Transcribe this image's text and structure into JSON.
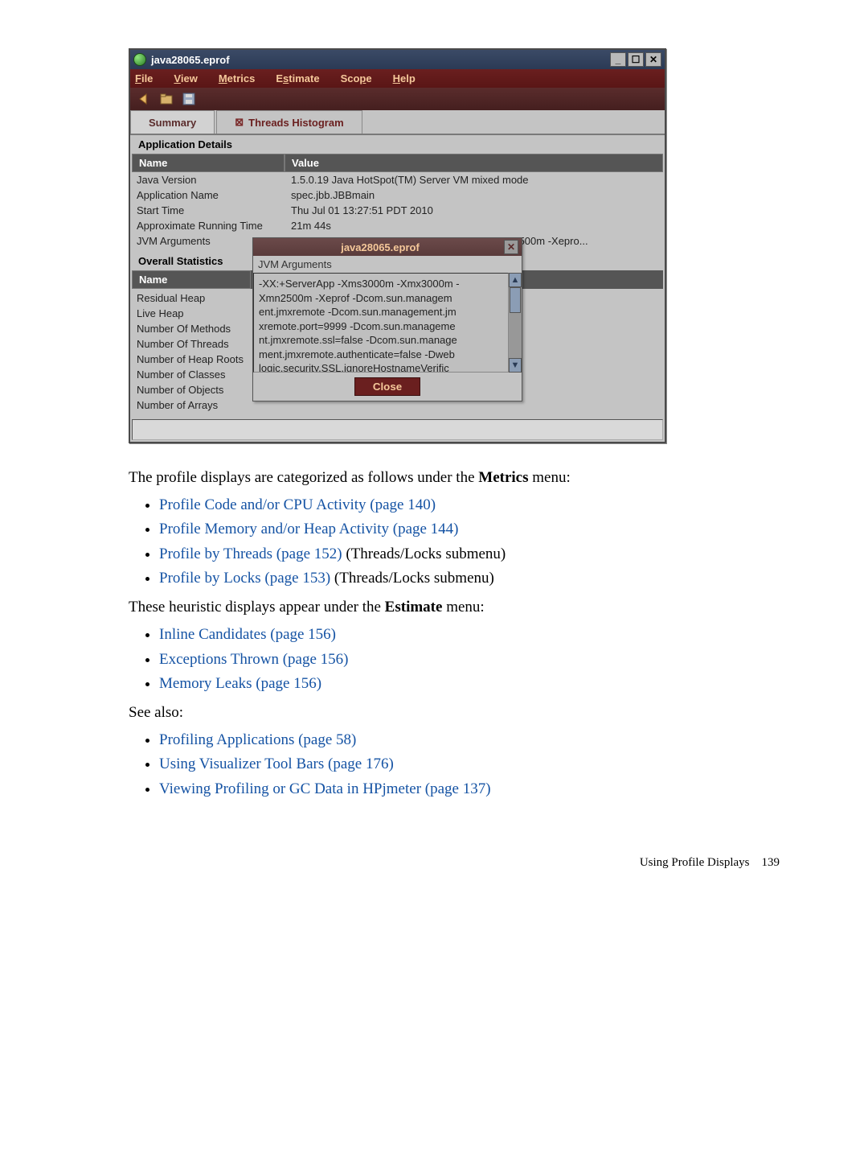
{
  "window": {
    "title": "java28065.eprof",
    "menus": [
      "File",
      "View",
      "Metrics",
      "Estimate",
      "Scope",
      "Help"
    ]
  },
  "tabs": {
    "summary": "Summary",
    "threads_histogram": "Threads Histogram"
  },
  "app_details": {
    "section_title": "Application Details",
    "header_name": "Name",
    "header_value": "Value",
    "rows": [
      {
        "name": "Java Version",
        "value": "1.5.0.19 Java HotSpot(TM) Server VM mixed mode"
      },
      {
        "name": "Application Name",
        "value": "spec.jbb.JBBmain"
      },
      {
        "name": "Start Time",
        "value": "Thu Jul 01 13:27:51 PDT 2010"
      },
      {
        "name": "Approximate Running Time",
        "value": "21m 44s"
      },
      {
        "name": "JVM Arguments",
        "value": "-XX:+ServerApp -Xms3000m -Xmx3000m -Xmn2500m -Xepro..."
      }
    ]
  },
  "overall_stats": {
    "section_title": "Overall Statistics",
    "header_name": "Name",
    "rows": [
      "Residual Heap",
      "Live Heap",
      "Number Of Methods",
      "Number Of Threads",
      "Number of Heap Roots",
      "Number of Classes",
      "Number of Objects",
      "Number of Arrays"
    ]
  },
  "popup": {
    "title": "java28065.eprof",
    "subtitle": "JVM Arguments",
    "text": "-XX:+ServerApp -Xms3000m -Xmx3000m -Xmn2500m -Xeprof  -Dcom.sun.managem ent.jmxremote -Dcom.sun.management.jm xremote.port=9999 -Dcom.sun.manageme nt.jmxremote.ssl=false -Dcom.sun.manage ment.jmxremote.authenticate=false -Dweb logic.security.SSL.ignoreHostnameVerific",
    "close_label": "Close"
  },
  "body": {
    "p1a": "The profile displays are categorized as follows under the ",
    "p1b": "Metrics",
    "p1c": " menu:",
    "l1": [
      {
        "link": "Profile Code and/or CPU Activity (page 140)",
        "suffix": ""
      },
      {
        "link": "Profile Memory and/or Heap Activity (page 144)",
        "suffix": ""
      },
      {
        "link": "Profile by Threads (page 152)",
        "suffix": " (Threads/Locks submenu)"
      },
      {
        "link": "Profile by Locks (page 153)",
        "suffix": " (Threads/Locks submenu)"
      }
    ],
    "p2a": "These heuristic displays appear under the ",
    "p2b": "Estimate",
    "p2c": " menu:",
    "l2": [
      "Inline Candidates (page 156)",
      "Exceptions Thrown (page 156)",
      "Memory Leaks (page 156)"
    ],
    "p3": "See also:",
    "l3": [
      "Profiling Applications  (page 58)",
      "Using Visualizer Tool Bars (page 176)",
      "Viewing Profiling or GC Data in HPjmeter (page 137)"
    ]
  },
  "footer": {
    "label": "Using Profile Displays",
    "page": "139"
  }
}
